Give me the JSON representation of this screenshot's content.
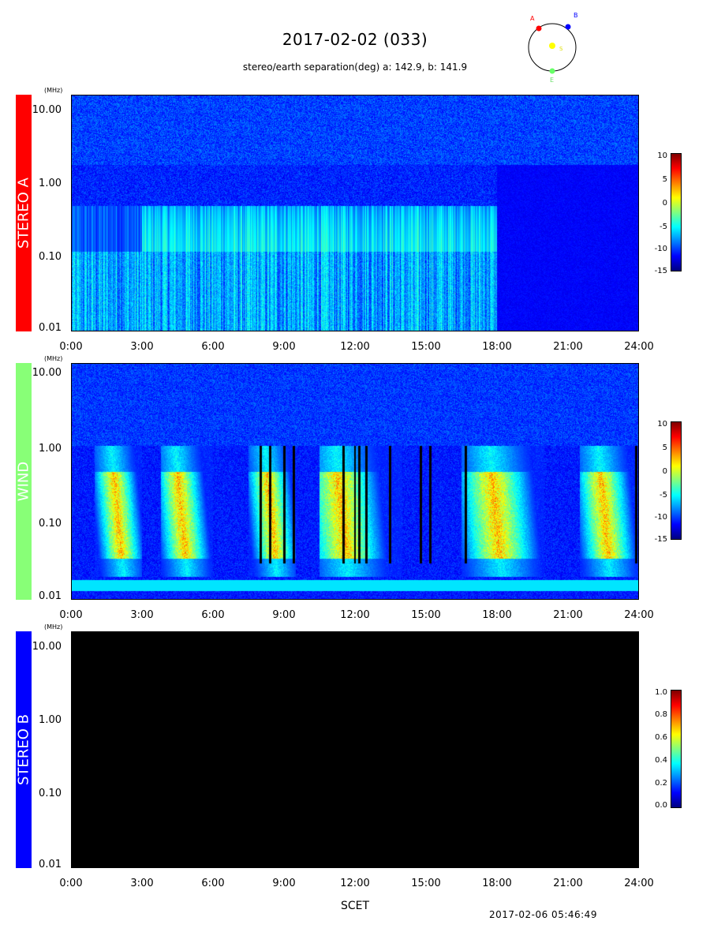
{
  "title": "2017-02-02 (033)",
  "subtitle": "stereo/earth separation(deg) a: 142.9, b: 141.9",
  "footer_timestamp": "2017-02-06 05:46:49",
  "x_axis_label": "SCET",
  "unit_label": "(MHz)",
  "orbit_diagram": {
    "labels": {
      "a": "A",
      "b": "B",
      "sun": "S",
      "earth": "E"
    },
    "colors": {
      "a": "#ff0000",
      "b": "#0000ff",
      "sun": "#ffff00",
      "earth": "#66ff66"
    }
  },
  "panels": [
    {
      "id": "stereo-a",
      "label": "STEREO A",
      "label_color": "#ff0000",
      "y_ticks": [
        "10.00",
        "1.00",
        "0.10",
        "0.01"
      ],
      "x_ticks": [
        "0:00",
        "3:00",
        "6:00",
        "9:00",
        "12:00",
        "15:00",
        "18:00",
        "21:00",
        "24:00"
      ],
      "colorbar_ticks": [
        "10",
        "5",
        "0",
        "-5",
        "-10",
        "-15"
      ]
    },
    {
      "id": "wind",
      "label": "WIND",
      "label_color": "#88ff77",
      "y_ticks": [
        "10.00",
        "1.00",
        "0.10",
        "0.01"
      ],
      "x_ticks": [
        "0:00",
        "3:00",
        "6:00",
        "9:00",
        "12:00",
        "15:00",
        "18:00",
        "21:00",
        "24:00"
      ],
      "colorbar_ticks": [
        "10",
        "5",
        "0",
        "-5",
        "-10",
        "-15"
      ]
    },
    {
      "id": "stereo-b",
      "label": "STEREO B",
      "label_color": "#0000ff",
      "y_ticks": [
        "10.00",
        "1.00",
        "0.10",
        "0.01"
      ],
      "x_ticks": [
        "0:00",
        "3:00",
        "6:00",
        "9:00",
        "12:00",
        "15:00",
        "18:00",
        "21:00",
        "24:00"
      ],
      "colorbar_ticks": [
        "1.0",
        "0.8",
        "0.6",
        "0.4",
        "0.2",
        "0.0"
      ]
    }
  ],
  "chart_data": [
    {
      "type": "heatmap",
      "panel": "STEREO A",
      "x_range_hours": [
        0,
        24
      ],
      "y_range_mhz": [
        0.01,
        16
      ],
      "y_scale": "log",
      "colorbar_range": [
        -15,
        10
      ],
      "features": [
        {
          "description_time_hours": [
            0,
            18
          ],
          "freq_mhz": [
            0.01,
            0.5
          ],
          "intensity": "elevated"
        },
        {
          "description_time_hours": [
            3,
            18
          ],
          "freq_mhz": [
            0.12,
            0.5
          ],
          "intensity": "elevated"
        }
      ]
    },
    {
      "type": "heatmap",
      "panel": "WIND",
      "x_range_hours": [
        0,
        24
      ],
      "y_range_mhz": [
        0.01,
        14
      ],
      "y_scale": "log",
      "colorbar_range": [
        -15,
        10
      ],
      "bursts_hours": [
        {
          "start": 1.0,
          "end": 3.0,
          "peak": 2.0
        },
        {
          "start": 3.8,
          "end": 6.0,
          "peak": 4.7
        },
        {
          "start": 7.5,
          "end": 9.5,
          "peak": 8.5
        },
        {
          "start": 10.5,
          "end": 14.0,
          "peak": 11.5
        },
        {
          "start": 16.5,
          "end": 20.0,
          "peak": 18.0
        },
        {
          "start": 21.5,
          "end": 24.0,
          "peak": 22.6
        }
      ],
      "persistent_band_mhz": 0.015
    },
    {
      "type": "heatmap",
      "panel": "STEREO B",
      "x_range_hours": [
        0,
        24
      ],
      "y_range_mhz": [
        0.01,
        16
      ],
      "y_scale": "log",
      "colorbar_range": [
        0.0,
        1.0
      ],
      "values": "no data"
    }
  ]
}
